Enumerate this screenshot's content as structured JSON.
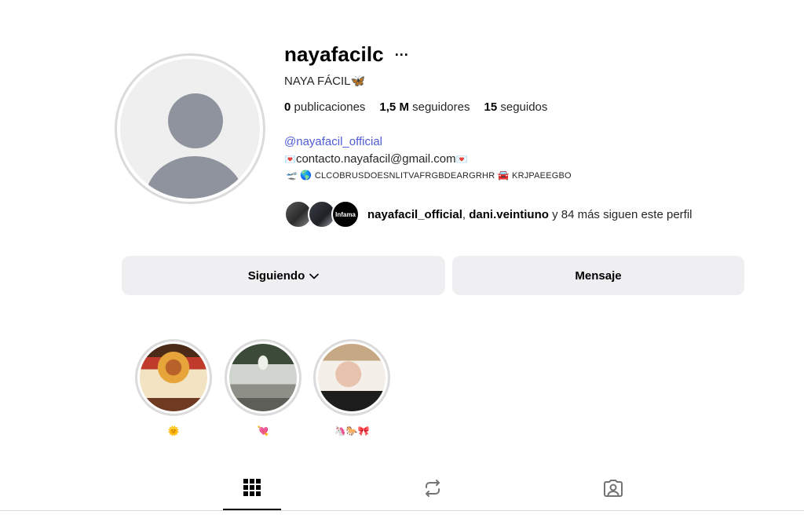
{
  "profile": {
    "username": "nayafacilc",
    "more_label": "···",
    "full_name": "NAYA FÁCIL🦋",
    "stats": {
      "posts_count": "0",
      "posts_label": "publicaciones",
      "followers_count": "1,5 M",
      "followers_label": "seguidores",
      "following_count": "15",
      "following_label": "seguidos"
    },
    "bio": {
      "link": "@nayafacil_official",
      "mail_prefix": "💌",
      "mail": "contacto.nayafacil@gmail.com",
      "mail_suffix": "💌",
      "flags_plane": "🛫",
      "flags_globe": "🌎",
      "flags_text": "CLCOBRUSDOESNLITVAFRGBDEARGRHR",
      "flags_car": "🚘",
      "flags_text2": "KRJPAEEGBO"
    },
    "followed_by": {
      "avatar3_text": "Infama",
      "user1": "nayafacil_official",
      "separator": ", ",
      "user2": "dani.veintiuno",
      "rest": " y 84 más siguen este perfil"
    }
  },
  "actions": {
    "following_label": "Siguiendo",
    "message_label": "Mensaje"
  },
  "highlights": [
    {
      "label": "🌞"
    },
    {
      "label": "💘"
    },
    {
      "label": "🦄🐎🎀"
    }
  ],
  "tabs": {
    "posts_icon": "grid-icon",
    "reposts_icon": "repost-icon",
    "tagged_icon": "tagged-user-icon",
    "active": "posts"
  },
  "colors": {
    "link": "#4f5bd5",
    "button_bg": "#efeff2",
    "avatar_placeholder": "#8e939e"
  }
}
